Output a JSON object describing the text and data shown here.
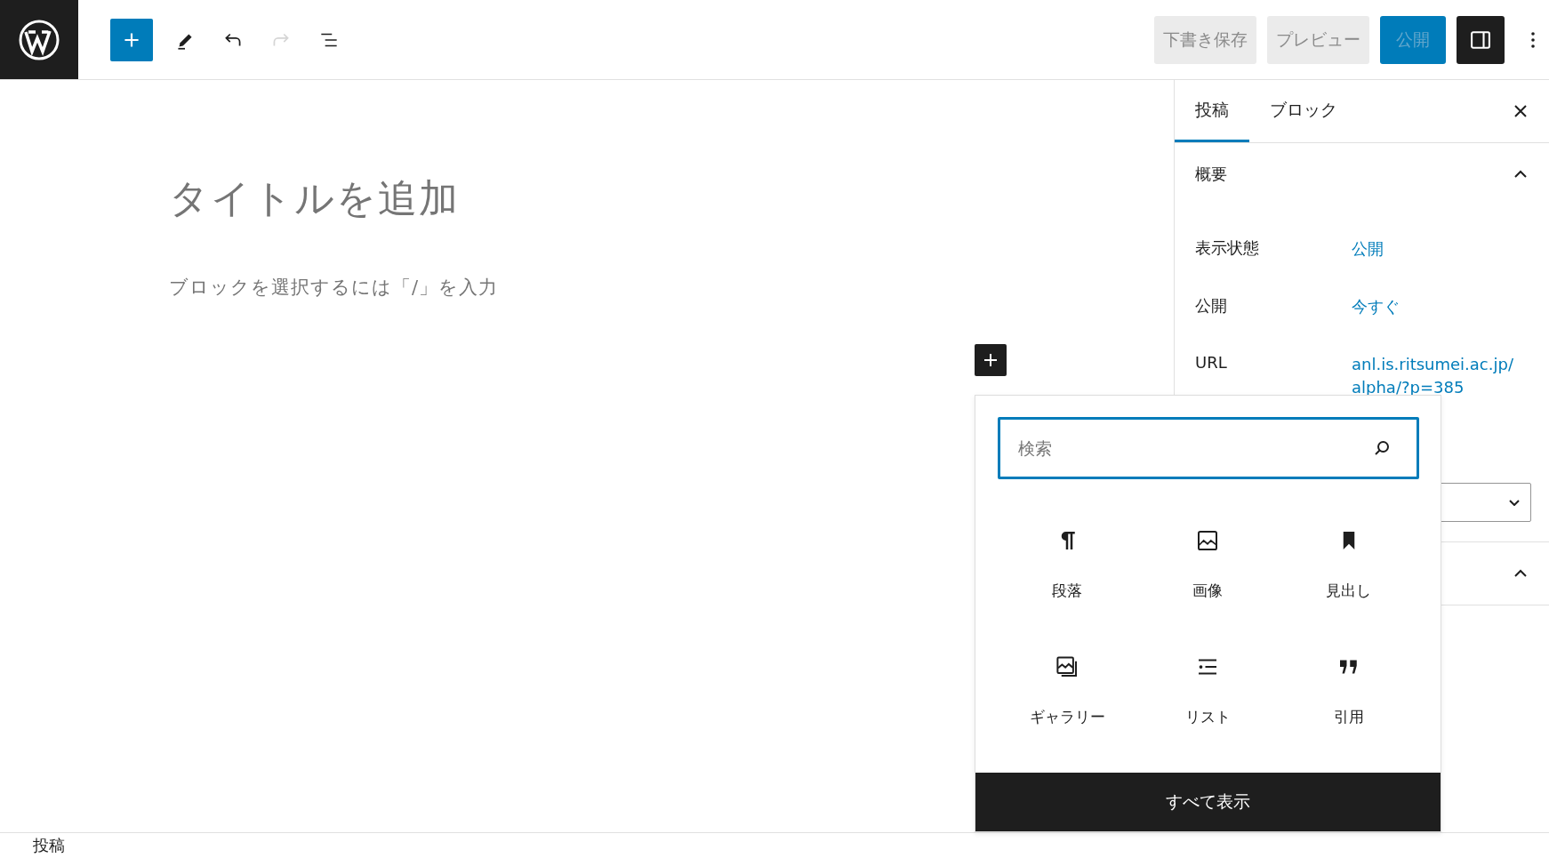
{
  "toolbar": {
    "tools": [
      {
        "kind": "add",
        "disabled": false
      },
      {
        "kind": "edit",
        "disabled": false
      },
      {
        "kind": "undo",
        "disabled": false
      },
      {
        "kind": "redo",
        "disabled": true
      },
      {
        "kind": "outline",
        "disabled": false
      }
    ],
    "actions": [
      {
        "label": "下書き保存",
        "kind": "secondary",
        "disabled": true
      },
      {
        "label": "プレビュー",
        "kind": "secondary",
        "disabled": true
      },
      {
        "label": "公開",
        "kind": "primary",
        "disabled": true
      }
    ],
    "settings_toggle": {
      "pressed": true
    }
  },
  "editor": {
    "title_placeholder": "タイトルを追加",
    "body_placeholder": "ブロックを選択するには「/」を入力"
  },
  "sidebar": {
    "tabs": [
      {
        "label": "投稿",
        "selected": true
      },
      {
        "label": "ブロック",
        "selected": false
      }
    ],
    "panels": [
      {
        "title": "概要",
        "expanded": true,
        "rows": [
          {
            "label": "表示状態",
            "value": "公開"
          },
          {
            "label": "公開",
            "value": "今すぐ"
          },
          {
            "label": "URL",
            "value": "anl.is.ritsumei.ac.jp/alpha/?p=385"
          }
        ]
      },
      {
        "expanded": true
      }
    ]
  },
  "inserter": {
    "search_placeholder": "検索",
    "blocks": [
      {
        "label": "段落",
        "kind": "paragraph"
      },
      {
        "label": "画像",
        "kind": "image"
      },
      {
        "label": "見出し",
        "kind": "heading"
      },
      {
        "label": "ギャラリー",
        "kind": "gallery"
      },
      {
        "label": "リスト",
        "kind": "list"
      },
      {
        "label": "引用",
        "kind": "quote"
      }
    ],
    "show_all": "すべて表示"
  },
  "status_bar": {
    "breadcrumb": "投稿"
  }
}
